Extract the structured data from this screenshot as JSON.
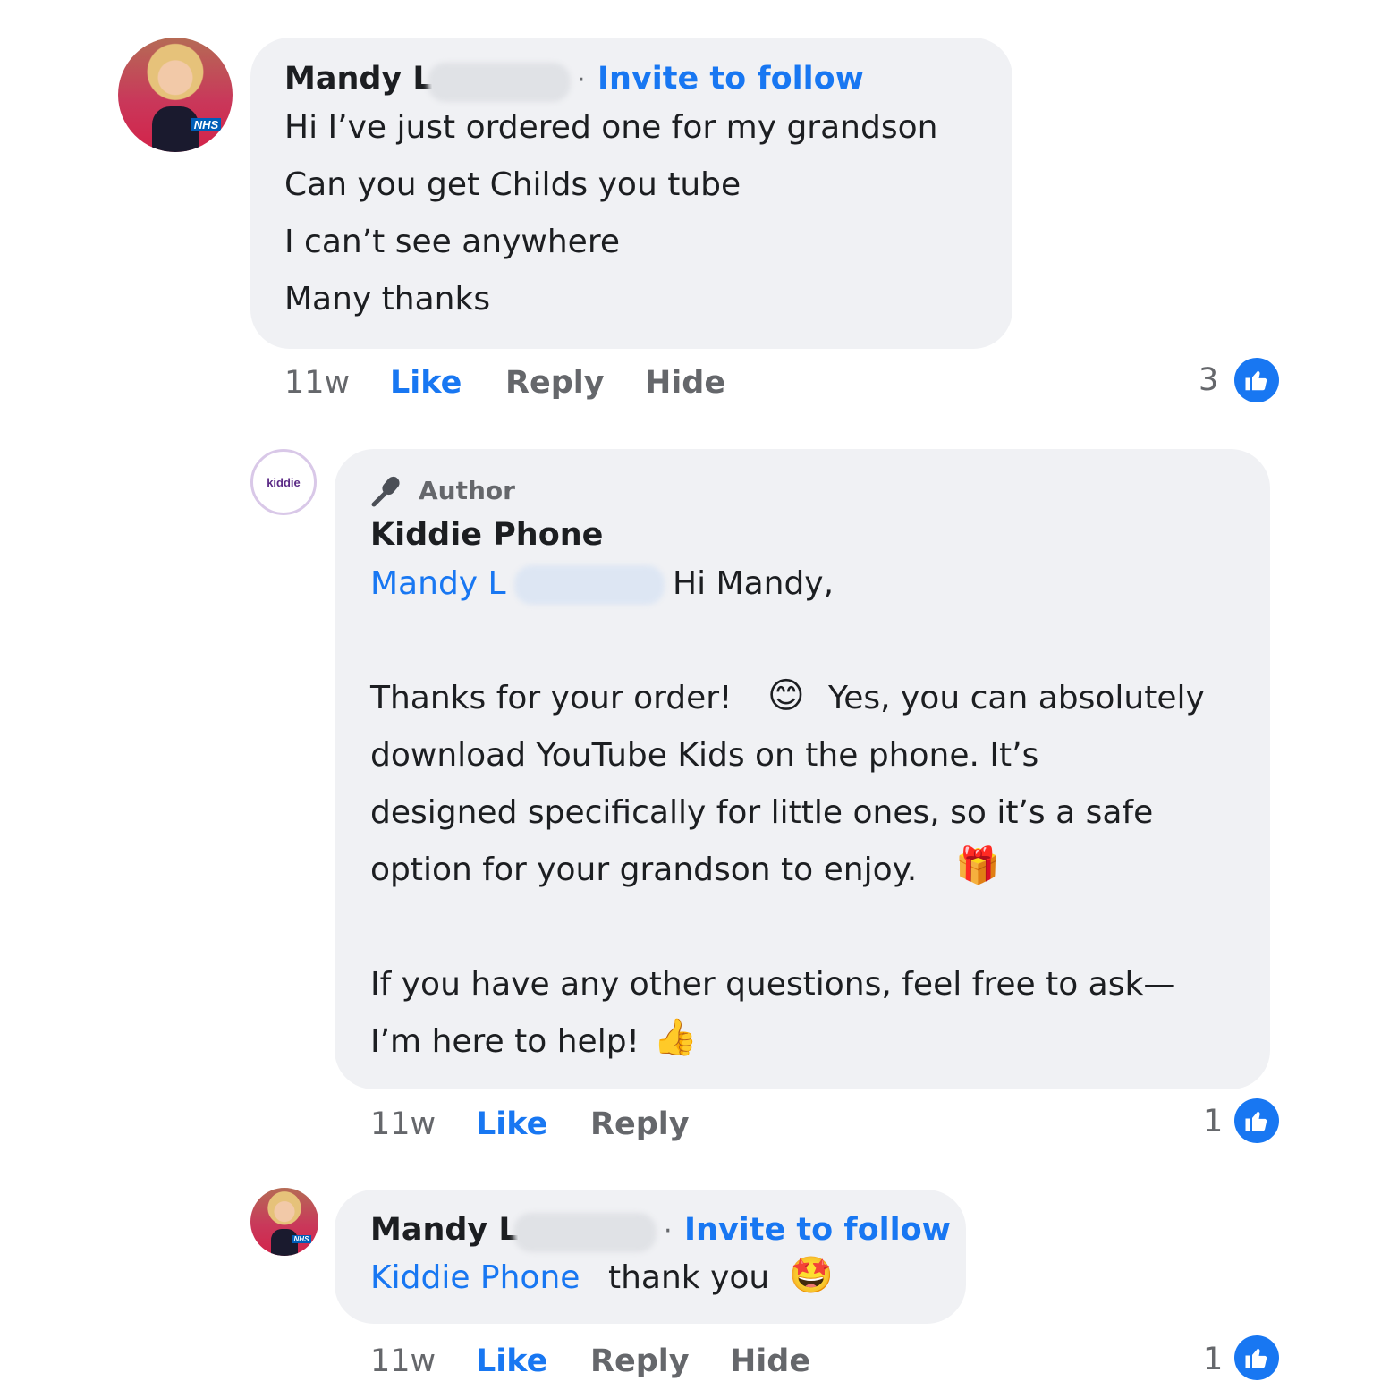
{
  "comments": [
    {
      "author": "Mandy L",
      "invite_label": "Invite to follow",
      "invite_separator": "·",
      "lines": [
        "Hi I’ve just ordered one for my grandson",
        "Can you get Childs you tube",
        "I can’t see anywhere",
        "Many thanks"
      ],
      "time": "11w",
      "like_label": "Like",
      "reply_label": "Reply",
      "hide_label": "Hide",
      "reaction_count": "3",
      "avatar_badge": "NHS"
    },
    {
      "author_badge": "Author",
      "author": "Kiddie Phone",
      "mention": "Mandy L",
      "greeting": "Hi Mandy,",
      "lines": [
        "Thanks for your order!",
        "Yes, you can absolutely",
        "download YouTube Kids on the phone. It’s",
        "designed specifically for little ones, so it’s a safe",
        "option for your grandson to enjoy.",
        "If you have any other questions, feel free to ask—",
        "I’m here to help!"
      ],
      "time": "11w",
      "like_label": "Like",
      "reply_label": "Reply",
      "reaction_count": "1",
      "avatar_logo": "kiddie"
    },
    {
      "author": "Mandy L",
      "invite_label": "Invite to follow",
      "invite_separator": "·",
      "mention": "Kiddie Phone",
      "text": "thank you",
      "time": "11w",
      "like_label": "Like",
      "reply_label": "Reply",
      "hide_label": "Hide",
      "reaction_count": "1",
      "avatar_badge": "NHS"
    }
  ],
  "icons": {
    "smile": "😊",
    "gift": "🎁",
    "thumbs_up": "👍",
    "star_struck": "🤩"
  },
  "colors": {
    "accent": "#1877f2",
    "bubble": "#f0f1f4",
    "muted": "#65676b"
  }
}
